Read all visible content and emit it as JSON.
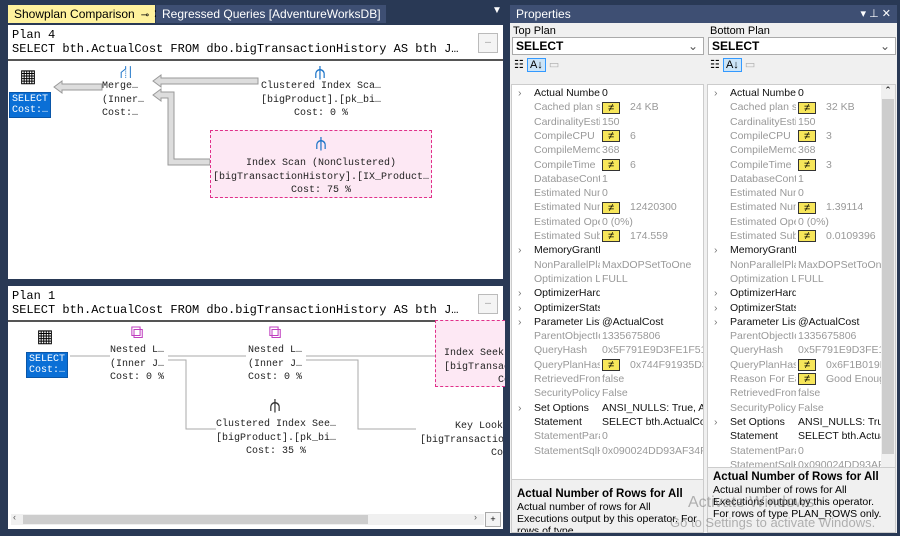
{
  "tabs": [
    {
      "label": "Showplan Comparison",
      "active": true
    },
    {
      "label": "Regressed Queries [AdventureWorksDB]"
    }
  ],
  "top_plan": {
    "title": "Plan 4",
    "query": "SELECT bth.ActualCost FROM dbo.bigTransactionHistory AS bth J…",
    "select": {
      "l1": "SELECT",
      "l2": "Cost:…"
    },
    "merge": {
      "l1": "Merge…",
      "l2": "(Inner…",
      "l3": "Cost:…"
    },
    "cis": {
      "l1": "Clustered Index Sca…",
      "l2": "[bigProduct].[pk_bi…",
      "l3": "Cost: 0 %"
    },
    "is": {
      "l1": "Index Scan (NonClustered)",
      "l2": "[bigTransactionHistory].[IX_Product…",
      "l3": "Cost: 75 %"
    }
  },
  "bottom_plan": {
    "title": "Plan 1",
    "query": "SELECT bth.ActualCost FROM dbo.bigTransactionHistory AS bth J…",
    "select": {
      "l1": "SELECT",
      "l2": "Cost:…"
    },
    "nl1": {
      "l1": "Nested L…",
      "l2": "(Inner J…",
      "l3": "Cost: 0 %"
    },
    "nl2": {
      "l1": "Nested L…",
      "l2": "(Inner J…",
      "l3": "Cost: 0 %"
    },
    "seek": {
      "l1": "Index Seek",
      "l2": "[bigTransac",
      "l3": "Co"
    },
    "cis": {
      "l1": "Clustered Index See…",
      "l2": "[bigProduct].[pk_bi…",
      "l3": "Cost: 35 %"
    },
    "kl": {
      "l1": "Key Look",
      "l2": "[bigTransactio",
      "l3": "Co"
    }
  },
  "properties": {
    "title": "Properties",
    "left": {
      "label": "Top Plan",
      "selected": "SELECT",
      "rows": [
        {
          "n": "Actual Number",
          "v": "0",
          "b": true,
          "e": true
        },
        {
          "n": "Cached plan size",
          "v": "24 KB",
          "d": true
        },
        {
          "n": "CardinalityEstimationModelVersion",
          "v": "150"
        },
        {
          "n": "CompileCPU",
          "v": "6",
          "d": true
        },
        {
          "n": "CompileMemory",
          "v": "368"
        },
        {
          "n": "CompileTime",
          "v": "6",
          "d": true
        },
        {
          "n": "DatabaseContextSettingsId",
          "v": "1"
        },
        {
          "n": "Estimated Number of Rows",
          "v": "0"
        },
        {
          "n": "Estimated Number of Rows for All Executions",
          "v": "12420300",
          "d": true
        },
        {
          "n": "Estimated Operator Cost",
          "v": "0 (0%)"
        },
        {
          "n": "Estimated Subtree Cost",
          "v": "174.559",
          "d": true
        },
        {
          "n": "MemoryGrantInfo",
          "v": "",
          "b": true,
          "e": true
        },
        {
          "n": "NonParallelPlanReason",
          "v": "MaxDOPSetToOne"
        },
        {
          "n": "Optimization Level",
          "v": "FULL"
        },
        {
          "n": "OptimizerHardwareDependentProperties",
          "v": "",
          "b": true,
          "e": true
        },
        {
          "n": "OptimizerStatsUsage",
          "v": "",
          "b": true,
          "e": true
        },
        {
          "n": "Parameter List",
          "v": "@ActualCost",
          "b": true,
          "e": true
        },
        {
          "n": "ParentObjectId",
          "v": "1335675806"
        },
        {
          "n": "QueryHash",
          "v": "0x5F791E9D3FE1F510"
        },
        {
          "n": "QueryPlanHash",
          "v": "0x744F91935D34",
          "d": true
        },
        {
          "n": "RetrievedFromCache",
          "v": "false"
        },
        {
          "n": "SecurityPolicyApplied",
          "v": "False"
        },
        {
          "n": "Set Options",
          "v": "ANSI_NULLS: True, AN",
          "b": true,
          "e": true
        },
        {
          "n": "Statement",
          "v": "SELECT bth.ActualCost",
          "b": true
        },
        {
          "n": "StatementParameterizationType",
          "v": "0"
        },
        {
          "n": "StatementSqlHandle",
          "v": "0x090024DD93AF34F9"
        }
      ],
      "desc_title": "Actual Number of Rows for All",
      "desc_text": "Actual number of rows for All Executions output by this operator. For rows of type ..."
    },
    "right": {
      "label": "Bottom Plan",
      "selected": "SELECT",
      "rows": [
        {
          "n": "Actual Number",
          "v": "0",
          "b": true,
          "e": true
        },
        {
          "n": "Cached plan size",
          "v": "32 KB",
          "d": true
        },
        {
          "n": "CardinalityEstimationModelVersion",
          "v": "150"
        },
        {
          "n": "CompileCPU",
          "v": "3",
          "d": true
        },
        {
          "n": "CompileMemory",
          "v": "368"
        },
        {
          "n": "CompileTime",
          "v": "3",
          "d": true
        },
        {
          "n": "DatabaseContextSettingsId",
          "v": "1"
        },
        {
          "n": "Estimated Number of Rows",
          "v": "0"
        },
        {
          "n": "Estimated Number of Rows for All Executions",
          "v": "1.39114",
          "d": true
        },
        {
          "n": "Estimated Operator Cost",
          "v": "0 (0%)"
        },
        {
          "n": "Estimated Subtree Cost",
          "v": "0.0109396",
          "d": true
        },
        {
          "n": "MemoryGrantInfo",
          "v": "",
          "b": true,
          "e": true
        },
        {
          "n": "NonParallelPlanReason",
          "v": "MaxDOPSetToOne"
        },
        {
          "n": "Optimization Level",
          "v": "FULL"
        },
        {
          "n": "OptimizerHardwareDependentProperties",
          "v": "",
          "b": true,
          "e": true
        },
        {
          "n": "OptimizerStatsUsage",
          "v": "",
          "b": true,
          "e": true
        },
        {
          "n": "Parameter List",
          "v": "@ActualCost",
          "b": true,
          "e": true
        },
        {
          "n": "ParentObjectId",
          "v": "1335675806"
        },
        {
          "n": "QueryHash",
          "v": "0x5F791E9D3FE1F"
        },
        {
          "n": "QueryPlanHash",
          "v": "0x6F1B019D2",
          "d": true
        },
        {
          "n": "Reason For Early Termination",
          "v": "Good Enough",
          "d": true
        },
        {
          "n": "RetrievedFromCache",
          "v": "false"
        },
        {
          "n": "SecurityPolicyApplied",
          "v": "False"
        },
        {
          "n": "Set Options",
          "v": "ANSI_NULLS: True",
          "b": true,
          "e": true
        },
        {
          "n": "Statement",
          "v": "SELECT bth.Actual",
          "b": true
        },
        {
          "n": "StatementParameterizationType",
          "v": "0"
        },
        {
          "n": "StatementSqlHandle",
          "v": "0x090024DD93AF3"
        }
      ],
      "desc_title": "Actual Number of Rows for All",
      "desc_text": "Actual number of rows for All Executions output by this operator. For rows of type PLAN_ROWS only."
    }
  },
  "watermark": {
    "l1": "Activate Windows",
    "l2": "Go to Settings to activate Windows."
  },
  "colors": {
    "chrome": "#293955",
    "selection": "#0a6fd6",
    "diff_highlight": "#fde8f4",
    "not_equal_badge": "#f7e65a"
  }
}
